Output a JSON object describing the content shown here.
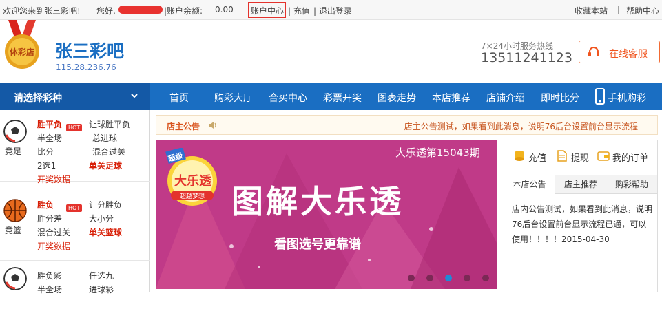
{
  "topbar": {
    "welcome": "欢迎您来到张三彩吧!",
    "greeting": "您好,",
    "balance_label": "|账户余额:",
    "balance_value": "0.00",
    "account_center": "账户中心",
    "recharge": "| 充值",
    "logout": "| 退出登录",
    "bookmark": "收藏本站",
    "divider": "|",
    "help": "帮助中心"
  },
  "header": {
    "logo_text": "体彩店",
    "brand": "张三彩吧",
    "ip": "115.28.236.76",
    "hotline_label": "7×24小时服务热线",
    "hotline": "13511241123",
    "kefu": "在线客服"
  },
  "nav": {
    "select_label": "请选择彩种",
    "items": [
      "首页",
      "购彩大厅",
      "合买中心",
      "彩票开奖",
      "图表走势",
      "本店推荐",
      "店铺介绍",
      "即时比分",
      "手机购彩"
    ]
  },
  "categories": [
    {
      "name": "竞足",
      "links": [
        "胜平负",
        "让球胜平负",
        "半全场",
        "总进球",
        "比分",
        "混合过关",
        "2选1",
        "单关足球",
        "开奖数据"
      ],
      "hot": "HOT"
    },
    {
      "name": "竞篮",
      "links": [
        "胜负",
        "让分胜负",
        "胜分差",
        "大小分",
        "混合过关",
        "单关篮球",
        "开奖数据"
      ],
      "hot": "HOT"
    },
    {
      "name": "",
      "links": [
        "胜负彩",
        "任选九",
        "半全场",
        "进球彩"
      ]
    }
  ],
  "notice": {
    "title": "店主公告",
    "message": "店主公告测试，如果看到此消息，说明76后台设置前台显示流程"
  },
  "banner": {
    "issue": "大乐透第15043期",
    "title": "图解大乐透",
    "subtitle": "看图选号更靠谱",
    "logo_top": "超级",
    "logo_main": "大乐透",
    "logo_bottom": "超越梦想"
  },
  "quick_actions": [
    "充值",
    "提现",
    "我的订单"
  ],
  "tabs": [
    "本店公告",
    "店主推荐",
    "购彩帮助"
  ],
  "announcement": "店内公告测试，如果看到此消息，说明76后台设置前台显示流程已通，可以使用！！！！2015-04-30",
  "colors": {
    "nav_blue": "#1a6ec2",
    "banner": "#c03a88",
    "accent_red": "#e4332d",
    "kefu_orange": "#f26b34"
  }
}
